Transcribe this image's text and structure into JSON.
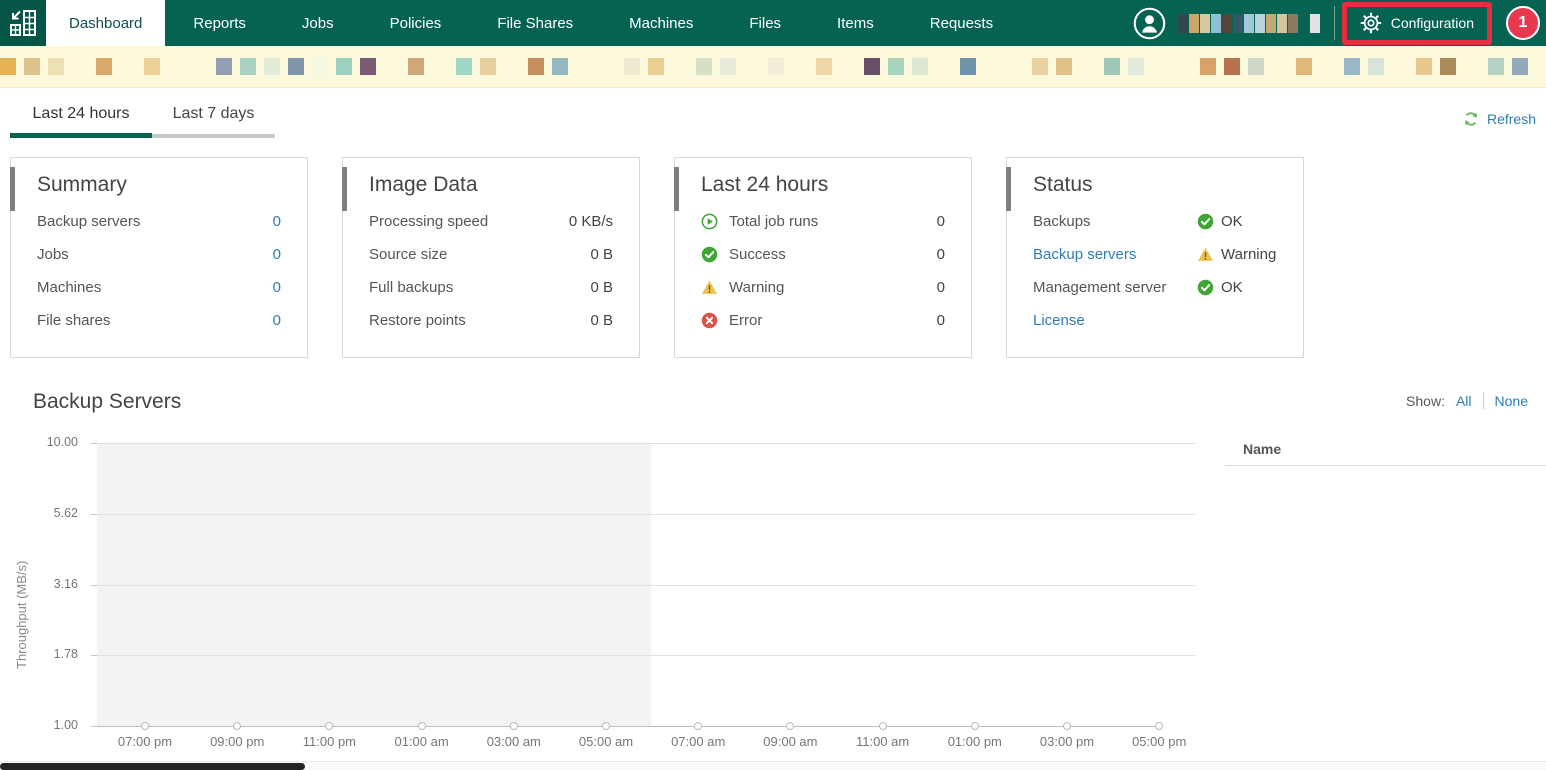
{
  "nav": {
    "tabs": [
      {
        "label": "Dashboard",
        "active": true
      },
      {
        "label": "Reports",
        "active": false
      },
      {
        "label": "Jobs",
        "active": false
      },
      {
        "label": "Policies",
        "active": false
      },
      {
        "label": "File Shares",
        "active": false
      },
      {
        "label": "Machines",
        "active": false
      },
      {
        "label": "Files",
        "active": false
      },
      {
        "label": "Items",
        "active": false
      },
      {
        "label": "Requests",
        "active": false
      }
    ],
    "configuration": {
      "label": "Configuration",
      "highlighted": true
    },
    "notification_badge": "1",
    "user_name_redacted_colors": [
      "#35464f",
      "#c9a76b",
      "#d8c9a0",
      "#8fc0d6",
      "#52453a",
      "#2e5a68",
      "#a3c8d8",
      "#bad3dc",
      "#c2aa78",
      "#d6c69c",
      "#8a7a5c",
      null,
      "#e2e2e2"
    ]
  },
  "redacted_strip_colors": [
    "#e5b254",
    "#dcc28b",
    "#ece0b4",
    null,
    "#d9a96c",
    null,
    "#ecd097",
    null,
    null,
    "#93a0b2",
    "#a9d2c2",
    "#e3ecd9",
    "#8095aa",
    "#f5f8e3",
    "#9ed1bf",
    "#7b5a74",
    null,
    "#d0a878",
    null,
    "#9fd6c6",
    "#e6cfa0",
    null,
    "#c88f5e",
    "#93b8bd",
    null,
    null,
    "#f0ead0",
    "#e9cf92",
    null,
    "#d8dfc8",
    "#eaeadb",
    null,
    "#f2eed8",
    null,
    "#f0d7a8",
    null,
    "#6b4f66",
    "#a8d4bc",
    "#dce8d4",
    null,
    "#6f93a8",
    null,
    null,
    "#e8d0a0",
    "#e3c289",
    null,
    "#9fc8b8",
    "#e2ead9",
    null,
    null,
    "#d9a269",
    "#b8724e",
    "#cfd8c8",
    null,
    "#e0b87a",
    null,
    "#9bb8c8",
    "#d8e4da",
    null,
    "#e8c88f",
    "#ad8a5a",
    null,
    "#b5d2c5",
    "#93a8b8"
  ],
  "toolbar": {
    "tabs": [
      {
        "label": "Last 24 hours",
        "active": true
      },
      {
        "label": "Last 7 days",
        "active": false
      }
    ],
    "refresh_label": "Refresh"
  },
  "cards": [
    {
      "id": "summary",
      "title": "Summary",
      "rows": [
        {
          "label": "Backup servers",
          "value": "0",
          "value_link": true
        },
        {
          "label": "Jobs",
          "value": "0",
          "value_link": true
        },
        {
          "label": "Machines",
          "value": "0",
          "value_link": true
        },
        {
          "label": "File shares",
          "value": "0",
          "value_link": true
        }
      ]
    },
    {
      "id": "image-data",
      "title": "Image Data",
      "rows": [
        {
          "label": "Processing speed",
          "value": "0 KB/s"
        },
        {
          "label": "Source size",
          "value": "0 B"
        },
        {
          "label": "Full backups",
          "value": "0 B"
        },
        {
          "label": "Restore points",
          "value": "0 B"
        }
      ]
    },
    {
      "id": "last-24-hours",
      "title": "Last 24 hours",
      "rows": [
        {
          "icon": "play-circle",
          "label": "Total job runs",
          "value": "0"
        },
        {
          "icon": "success-circle",
          "label": "Success",
          "value": "0"
        },
        {
          "icon": "warning-triangle",
          "label": "Warning",
          "value": "0"
        },
        {
          "icon": "error-circle",
          "label": "Error",
          "value": "0"
        }
      ]
    },
    {
      "id": "status",
      "title": "Status",
      "rows": [
        {
          "label": "Backups",
          "status_icon": "success-circle",
          "status": "OK"
        },
        {
          "label": "Backup servers",
          "label_link": true,
          "status_icon": "warning-triangle",
          "status": "Warning"
        },
        {
          "label": "Management server",
          "status_icon": "success-circle",
          "status": "OK"
        },
        {
          "label": "License",
          "label_link": true
        }
      ]
    }
  ],
  "backup_servers_section": {
    "title": "Backup Servers",
    "show_label": "Show:",
    "show_all": "All",
    "show_none": "None",
    "table_header": "Name"
  },
  "chart_data": {
    "type": "line",
    "title": "Backup Servers",
    "ylabel": "Throughput (MB/s)",
    "yscale": "log",
    "ylim": [
      1,
      10
    ],
    "ytick_labels": [
      "10.00",
      "5.62",
      "3.16",
      "1.78",
      "1.00"
    ],
    "x": [
      "07:00 pm",
      "09:00 pm",
      "11:00 pm",
      "01:00 am",
      "03:00 am",
      "05:00 am",
      "07:00 am",
      "09:00 am",
      "11:00 am",
      "01:00 pm",
      "03:00 pm",
      "05:00 pm"
    ],
    "series": [
      {
        "name": "throughput",
        "values": [
          1,
          1,
          1,
          1,
          1,
          1,
          1,
          1,
          1,
          1,
          1,
          1
        ]
      }
    ],
    "grid": true,
    "legend": "none",
    "shaded_region": {
      "from_x": "07:00 pm",
      "to_x": "06:00 am"
    }
  },
  "colors": {
    "nav_green": "#066352",
    "strip_bg": "#fbf8dc",
    "link_blue": "#2e7db2",
    "success_green": "#3fa535",
    "warning_yellow": "#eec14d",
    "error_red": "#d9534f",
    "badge_red": "#e8394e",
    "highlight_red": "#e62e3e",
    "refresh_green": "#5cb85c",
    "card_accent_gray": "#7f7f7f"
  }
}
